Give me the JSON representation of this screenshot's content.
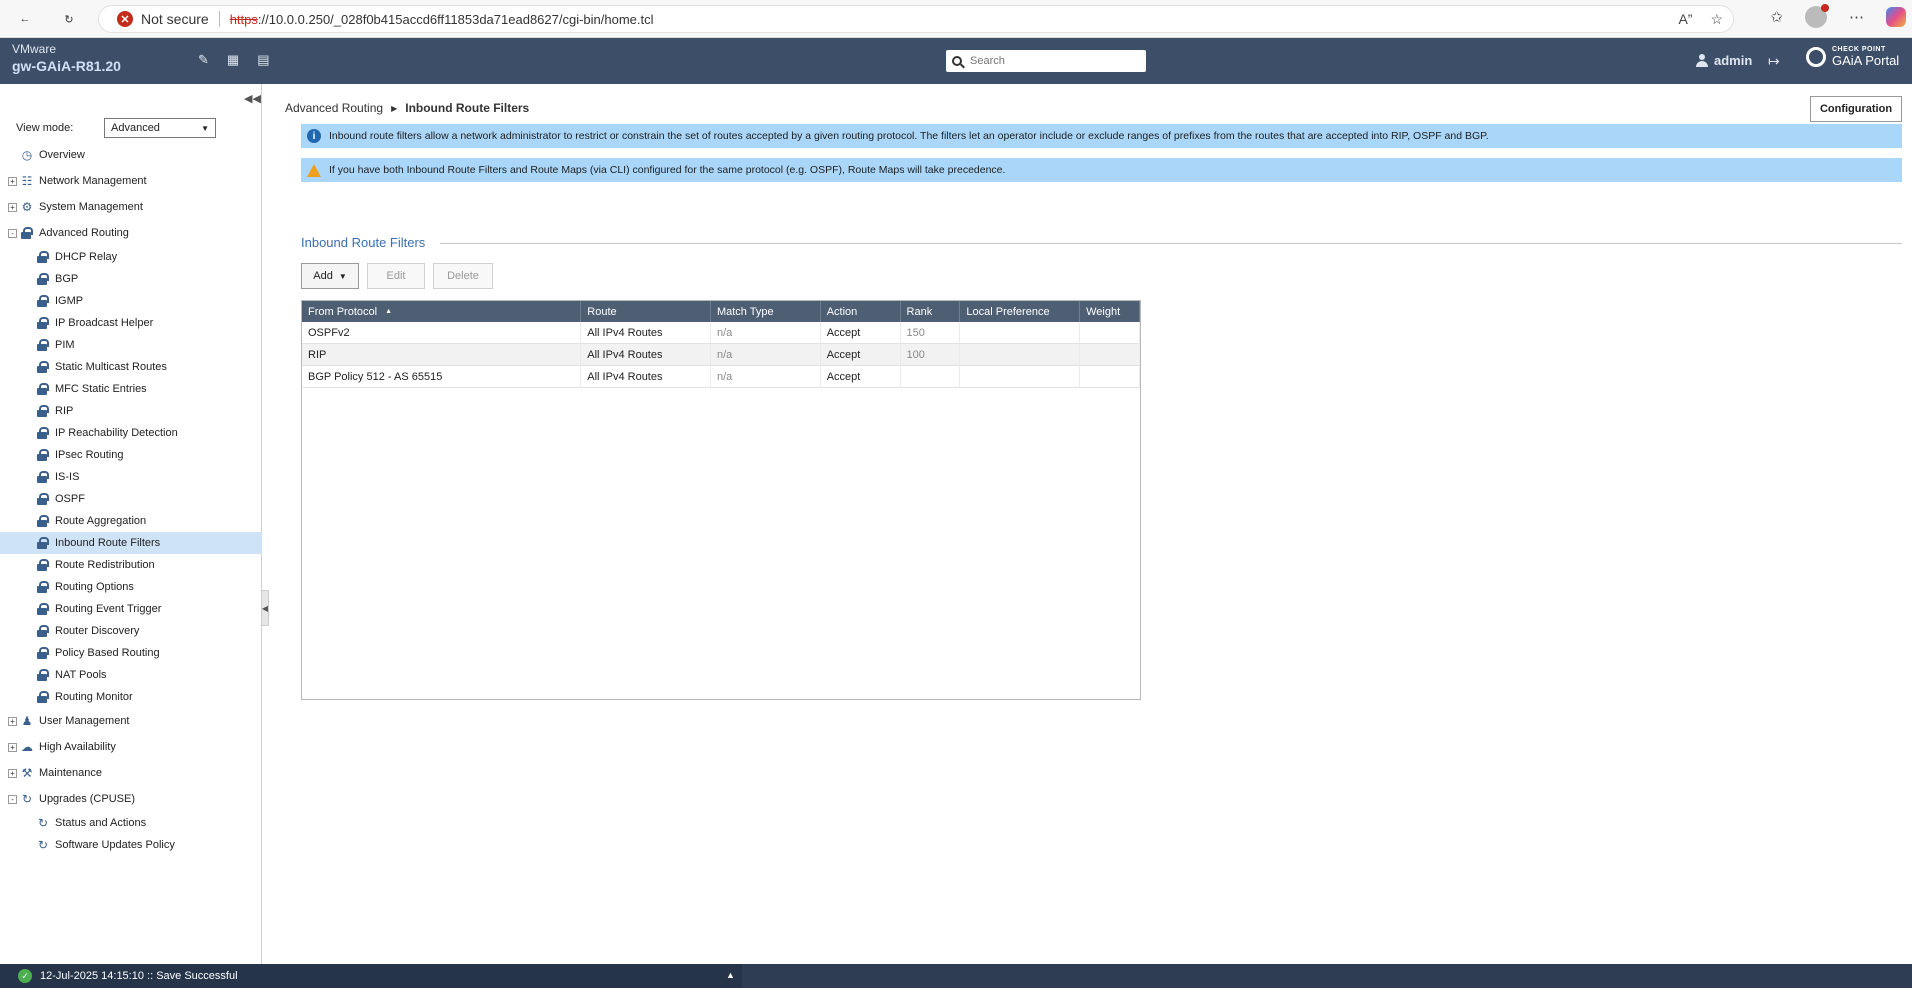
{
  "browser": {
    "not_secure": "Not secure",
    "url_scheme": "https",
    "url_rest": "://10.0.0.250/_028f0b415accd6ff11853da71ead8627/cgi-bin/home.tcl"
  },
  "header": {
    "vendor": "VMware",
    "hostname": "gw-GAiA-R81.20",
    "search_placeholder": "Search",
    "user": "admin",
    "logo_small": "CHECK POINT",
    "logo_big": "GAiA Portal"
  },
  "sidebar": {
    "view_mode_label": "View mode:",
    "view_mode_value": "Advanced",
    "items": [
      {
        "label": "Overview",
        "level": 0,
        "icon": "overview-icon"
      },
      {
        "label": "Network Management",
        "level": 0,
        "icon": "network-icon",
        "expander": "+"
      },
      {
        "label": "System Management",
        "level": 0,
        "icon": "gear-icon",
        "expander": "+"
      },
      {
        "label": "Advanced Routing",
        "level": 0,
        "icon": "lock-icon",
        "expander": "-"
      },
      {
        "label": "DHCP Relay",
        "level": 1,
        "icon": "lock-icon"
      },
      {
        "label": "BGP",
        "level": 1,
        "icon": "lock-icon"
      },
      {
        "label": "IGMP",
        "level": 1,
        "icon": "lock-icon"
      },
      {
        "label": "IP Broadcast Helper",
        "level": 1,
        "icon": "lock-icon"
      },
      {
        "label": "PIM",
        "level": 1,
        "icon": "lock-icon"
      },
      {
        "label": "Static Multicast Routes",
        "level": 1,
        "icon": "lock-icon"
      },
      {
        "label": "MFC Static Entries",
        "level": 1,
        "icon": "lock-icon"
      },
      {
        "label": "RIP",
        "level": 1,
        "icon": "lock-icon"
      },
      {
        "label": "IP Reachability Detection",
        "level": 1,
        "icon": "lock-icon"
      },
      {
        "label": "IPsec Routing",
        "level": 1,
        "icon": "lock-icon"
      },
      {
        "label": "IS-IS",
        "level": 1,
        "icon": "lock-icon"
      },
      {
        "label": "OSPF",
        "level": 1,
        "icon": "lock-icon"
      },
      {
        "label": "Route Aggregation",
        "level": 1,
        "icon": "lock-icon"
      },
      {
        "label": "Inbound Route Filters",
        "level": 1,
        "icon": "lock-icon",
        "selected": true
      },
      {
        "label": "Route Redistribution",
        "level": 1,
        "icon": "lock-icon"
      },
      {
        "label": "Routing Options",
        "level": 1,
        "icon": "lock-icon"
      },
      {
        "label": "Routing Event Trigger",
        "level": 1,
        "icon": "lock-icon"
      },
      {
        "label": "Router Discovery",
        "level": 1,
        "icon": "lock-icon"
      },
      {
        "label": "Policy Based Routing",
        "level": 1,
        "icon": "lock-icon"
      },
      {
        "label": "NAT Pools",
        "level": 1,
        "icon": "lock-icon"
      },
      {
        "label": "Routing Monitor",
        "level": 1,
        "icon": "lock-icon"
      },
      {
        "label": "User Management",
        "level": 0,
        "icon": "users-icon",
        "expander": "+"
      },
      {
        "label": "High Availability",
        "level": 0,
        "icon": "cluster-icon",
        "expander": "+"
      },
      {
        "label": "Maintenance",
        "level": 0,
        "icon": "wrench-icon",
        "expander": "+"
      },
      {
        "label": "Upgrades (CPUSE)",
        "level": 0,
        "icon": "refresh-icon",
        "expander": "-"
      },
      {
        "label": "Status and Actions",
        "level": 1,
        "icon": "refresh-icon"
      },
      {
        "label": "Software Updates Policy",
        "level": 1,
        "icon": "refresh-icon"
      }
    ]
  },
  "main": {
    "breadcrumb": [
      "Advanced Routing",
      "Inbound Route Filters"
    ],
    "config_button": "Configuration",
    "info_text": "Inbound route filters allow a network administrator to restrict or constrain the set of routes accepted by a given routing protocol. The filters let an operator include or exclude ranges of prefixes from the routes that are accepted into RIP, OSPF and BGP.",
    "warn_text": "If you have both Inbound Route Filters and Route Maps (via CLI) configured for the same protocol (e.g. OSPF), Route Maps will take precedence.",
    "section_title": "Inbound Route Filters",
    "toolbar": {
      "add": "Add",
      "edit": "Edit",
      "delete": "Delete"
    },
    "table": {
      "columns": [
        "From Protocol",
        "Route",
        "Match Type",
        "Action",
        "Rank",
        "Local Preference",
        "Weight"
      ],
      "rows": [
        {
          "protocol": "OSPFv2",
          "route": "All IPv4 Routes",
          "match": "n/a",
          "action": "Accept",
          "rank": "150",
          "localpref": "",
          "weight": ""
        },
        {
          "protocol": "RIP",
          "route": "All IPv4 Routes",
          "match": "n/a",
          "action": "Accept",
          "rank": "100",
          "localpref": "",
          "weight": ""
        },
        {
          "protocol": "BGP Policy 512 - AS 65515",
          "route": "All IPv4 Routes",
          "match": "n/a",
          "action": "Accept",
          "rank": "",
          "localpref": "",
          "weight": ""
        }
      ]
    }
  },
  "status": {
    "message": "12-Jul-2025 14:15:10 :: Save Successful"
  }
}
